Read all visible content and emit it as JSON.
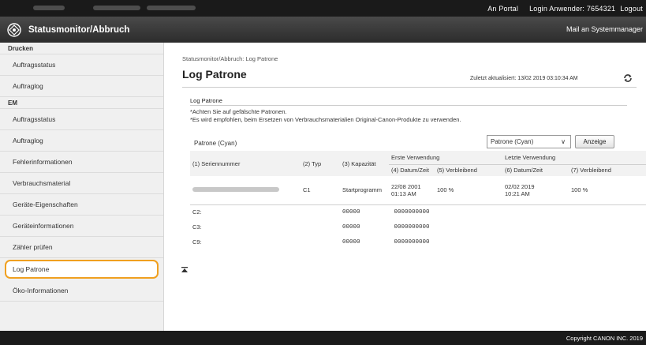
{
  "topbar": {
    "portal_link": "An Portal",
    "login_user": "Login Anwender:  7654321",
    "logout": "Logout"
  },
  "header": {
    "app_title": "Statusmonitor/Abbruch",
    "mail_link": "Mail an Systemmanager"
  },
  "sidebar": {
    "sections": [
      {
        "title": "Drucken",
        "items": [
          {
            "label": "Auftragsstatus",
            "active": false
          },
          {
            "label": "Auftraglog",
            "active": false
          }
        ]
      },
      {
        "title": "EM",
        "items": [
          {
            "label": "Auftragsstatus",
            "active": false
          },
          {
            "label": "Auftraglog",
            "active": false
          },
          {
            "label": "Fehlerinformationen",
            "active": false
          },
          {
            "label": "Verbrauchsmaterial",
            "active": false
          },
          {
            "label": "Geräte-Eigenschaften",
            "active": false
          },
          {
            "label": "Geräteinformationen",
            "active": false
          },
          {
            "label": "Zähler prüfen",
            "active": false
          },
          {
            "label": "Log Patrone",
            "active": true
          },
          {
            "label": "Öko-Informationen",
            "active": false
          }
        ]
      }
    ]
  },
  "main": {
    "breadcrumb": "Statusmonitor/Abbruch: Log Patrone",
    "title": "Log Patrone",
    "last_updated": "Zuletzt aktualisiert: 13/02 2019 03:10:34 AM",
    "section_title": "Log Patrone",
    "notes": [
      "*Achten Sie auf gefälschte Patronen.",
      "*Es wird empfohlen, beim Ersetzen von Verbrauchsmaterialien Original-Canon-Produkte zu verwenden."
    ],
    "cartridge_label": "Patrone (Cyan)",
    "cartridge_select_value": "Patrone (Cyan)",
    "show_button": "Anzeige",
    "table": {
      "columns": {
        "serial": "(1) Seriennummer",
        "type": "(2) Typ",
        "capacity": "(3) Kapazität",
        "first_use_group": "Erste Verwendung",
        "first_datetime": "(4) Datum/Zeit",
        "first_remaining": "(5) Verbleibend",
        "last_use_group": "Letzte Verwendung",
        "last_datetime": "(6) Datum/Zeit",
        "last_remaining": "(7) Verbleibend"
      },
      "first_row": {
        "type": "C1",
        "capacity": "Startprogramm",
        "first_date": "22/08 2001",
        "first_time": "01:13 AM",
        "first_remaining": "100 %",
        "last_date": "02/02 2019",
        "last_time": "10:21 AM",
        "last_remaining": "100 %"
      },
      "extra_rows": [
        {
          "label": "C2:",
          "code": "00000",
          "value": "0000000000"
        },
        {
          "label": "C3:",
          "code": "00000",
          "value": "0000000000"
        },
        {
          "label": "C9:",
          "code": "00000",
          "value": "0000000000"
        }
      ]
    }
  },
  "footer": {
    "copyright": "Copyright CANON INC. 2019"
  },
  "icons": {
    "logo": "canon-remote-ui-logo-icon",
    "refresh": "refresh-icon",
    "collapse": "collapse-up-icon",
    "select_arrow": "chevron-down-icon"
  },
  "colors": {
    "active_highlight": "#f0a020",
    "topbar": "#1a1a1a",
    "sidebar": "#f0f0f0"
  }
}
